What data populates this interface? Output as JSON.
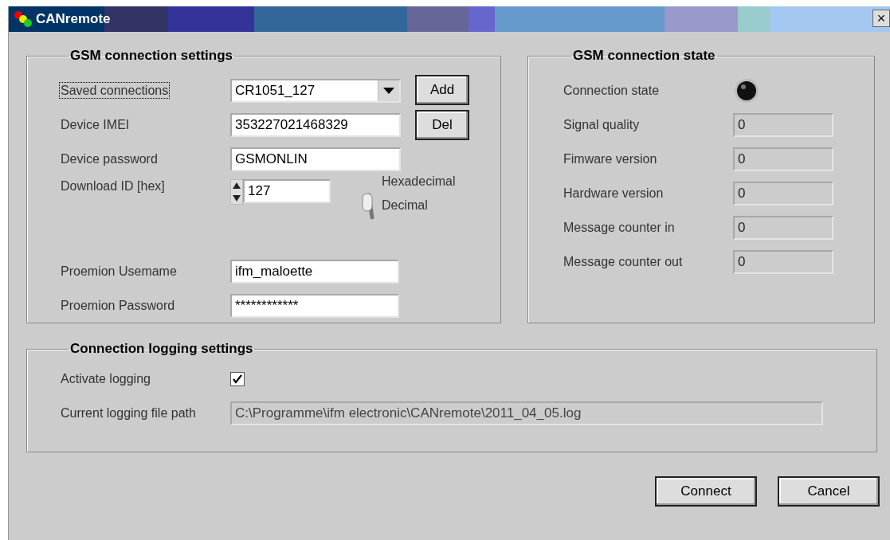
{
  "window": {
    "title": "CANremote",
    "close": "×"
  },
  "gsm_settings": {
    "title": "GSM connection settings",
    "saved_connections": {
      "label": "Saved connections",
      "value": "CR1051_127",
      "focused": true
    },
    "buttons": [
      {
        "label": "Add"
      },
      {
        "label": "Del"
      }
    ],
    "fields": [
      {
        "label": "Device IMEI",
        "value": "353227021468329"
      },
      {
        "label": "Device password",
        "value": "GSMONLIN"
      }
    ],
    "download_id": {
      "label": "Download ID [hex]",
      "value": "127"
    },
    "format": {
      "options": [
        "Hexadecimal",
        "Decimal"
      ],
      "decimal": true
    },
    "account_fields": [
      {
        "label": "Proemion Usemame",
        "value": "ifm_maloette"
      },
      {
        "label": "Proemion Password",
        "value": "************"
      }
    ]
  },
  "gsm_state": {
    "title": "GSM connection state",
    "connection_state": {
      "label": "Connection state",
      "on": false
    },
    "fields": [
      {
        "label": "Signal quality",
        "value": "0"
      },
      {
        "label": "Fimware version",
        "value": "0"
      },
      {
        "label": "Hardware version",
        "value": "0"
      },
      {
        "label": "Message counter in",
        "value": "0"
      },
      {
        "label": "Message counter out",
        "value": "0"
      }
    ]
  },
  "logging": {
    "title": "Connection logging settings",
    "activate": {
      "label": "Activate logging",
      "checked": true
    },
    "path": {
      "label": "Current logging file path",
      "value": "C:\\Programme\\ifm electronic\\CANremote\\2011_04_05.log"
    }
  },
  "actions": [
    {
      "label": "Connect"
    },
    {
      "label": "Cancel"
    }
  ]
}
